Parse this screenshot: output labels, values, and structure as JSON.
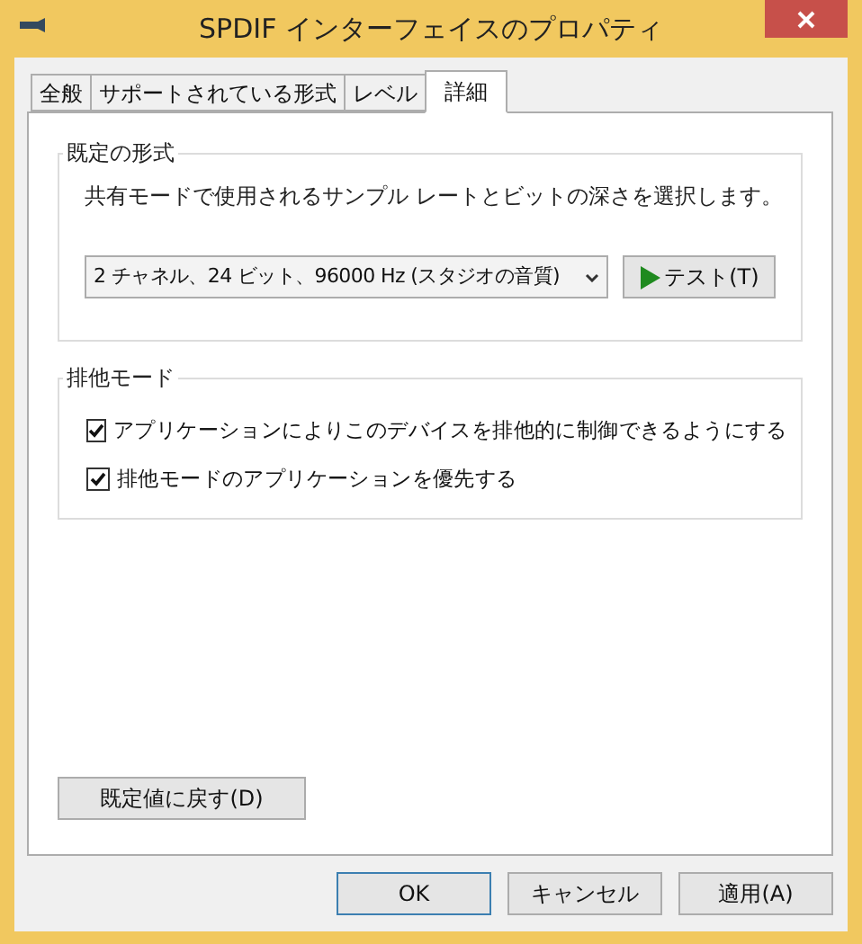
{
  "window": {
    "title": "SPDIF インターフェイスのプロパティ"
  },
  "tabs": [
    {
      "label": "全般",
      "selected": false
    },
    {
      "label": "サポートされている形式",
      "selected": false
    },
    {
      "label": "レベル",
      "selected": false
    },
    {
      "label": "詳細",
      "selected": true
    }
  ],
  "default_format": {
    "title": "既定の形式",
    "description": "共有モードで使用されるサンプル レートとビットの深さを選択します。",
    "format": "2 チャネル、24 ビット、96000 Hz (スタジオの音質)",
    "test_button": "テスト(T)"
  },
  "exclusive_mode": {
    "title": "排他モード",
    "options": [
      {
        "label": "アプリケーションによりこのデバイスを排他的に制御できるようにする",
        "checked": true
      },
      {
        "label": "排他モードのアプリケーションを優先する",
        "checked": true
      }
    ]
  },
  "restore_button": "既定値に戻す(D)",
  "buttons": [
    {
      "label": "OK",
      "default": true
    },
    {
      "label": "キャンセル",
      "default": false
    },
    {
      "label": "適用(A)",
      "default": false
    }
  ]
}
